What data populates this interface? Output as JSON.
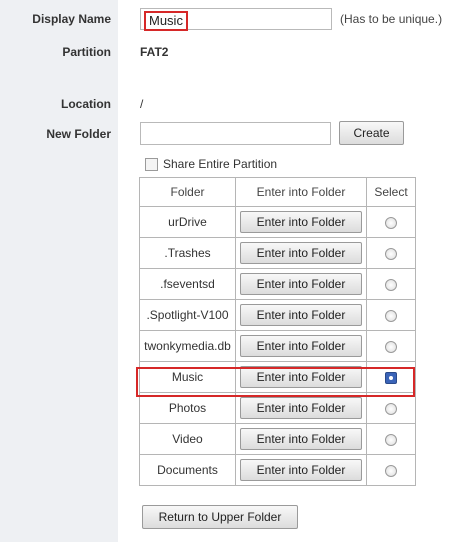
{
  "form": {
    "display_name_label": "Display Name",
    "display_name_value": "Music",
    "display_name_hint": "(Has to be unique.)",
    "partition_label": "Partition",
    "partition_value": "FAT2",
    "location_label": "Location",
    "location_value": "/",
    "new_folder_label": "New Folder",
    "new_folder_value": "",
    "create_button": "Create",
    "share_entire_partition": "Share Entire Partition",
    "share_entire_partition_checked": false
  },
  "table": {
    "headers": [
      "Folder",
      "Enter into Folder",
      "Select"
    ],
    "rows": [
      {
        "folder": "urDrive",
        "action": "Enter into Folder",
        "selected": false
      },
      {
        "folder": ".Trashes",
        "action": "Enter into Folder",
        "selected": false
      },
      {
        "folder": ".fseventsd",
        "action": "Enter into Folder",
        "selected": false
      },
      {
        "folder": ".Spotlight-V100",
        "action": "Enter into Folder",
        "selected": false
      },
      {
        "folder": "twonkymedia.db",
        "action": "Enter into Folder",
        "selected": false
      },
      {
        "folder": "Music",
        "action": "Enter into Folder",
        "selected": true
      },
      {
        "folder": "Photos",
        "action": "Enter into Folder",
        "selected": false
      },
      {
        "folder": "Video",
        "action": "Enter into Folder",
        "selected": false
      },
      {
        "folder": "Documents",
        "action": "Enter into Folder",
        "selected": false
      }
    ]
  },
  "footer": {
    "return_button": "Return to Upper Folder"
  },
  "colors": {
    "highlight": "#d62828",
    "label_column_bg": "#eef0f3"
  }
}
